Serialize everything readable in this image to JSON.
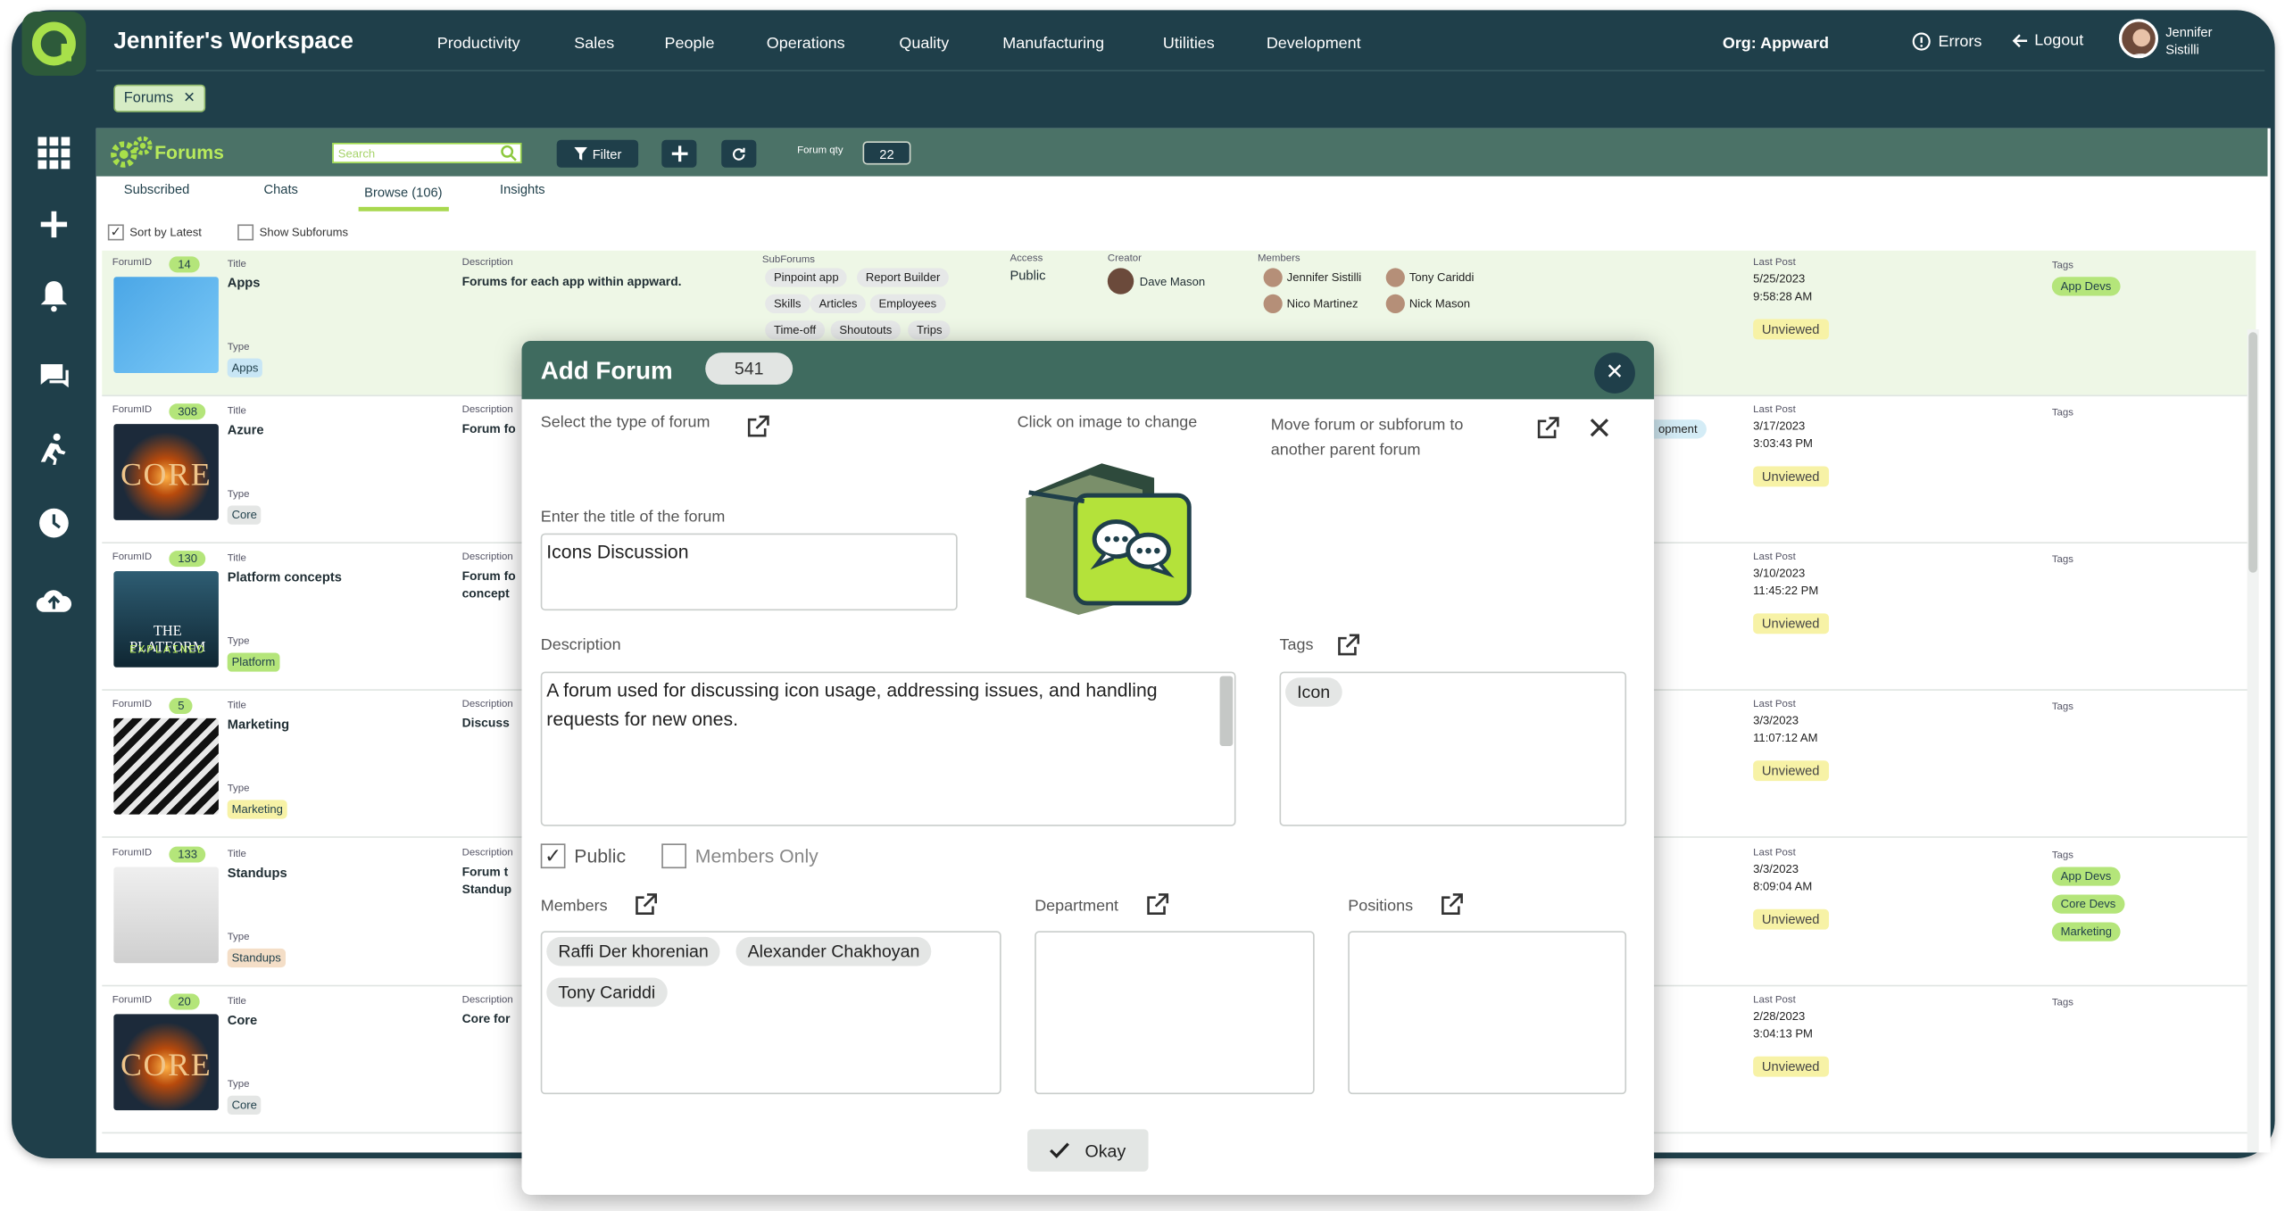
{
  "app": {
    "workspace_title": "Jennifer's Workspace",
    "menu": [
      "Productivity",
      "Sales",
      "People",
      "Operations",
      "Quality",
      "Manufacturing",
      "Utilities",
      "Development"
    ],
    "org_label": "Org:",
    "org_value": "Appward",
    "errors_label": "Errors",
    "logout_label": "Logout",
    "user_first": "Jennifer",
    "user_last": "Sistilli",
    "open_tab": "Forums",
    "colors": {
      "rail": "#1f3f4a",
      "accent": "#a8d84f",
      "toolbar": "#4b7267"
    }
  },
  "toolbar": {
    "title": "Forums",
    "search_placeholder": "Search",
    "filter_label": "Filter",
    "qty_label": "Forum qty",
    "qty_value": "22"
  },
  "subtabs": [
    "Subscribed",
    "Chats",
    "Browse (106)",
    "Insights"
  ],
  "options": {
    "sort_latest": "Sort by Latest",
    "show_subforums": "Show Subforums"
  },
  "labels": {
    "forum_id": "ForumID",
    "title": "Title",
    "type": "Type",
    "description": "Description",
    "subforums": "SubForums",
    "access": "Access",
    "creator": "Creator",
    "members": "Members",
    "last_post": "Last Post",
    "tags": "Tags",
    "unviewed": "Unviewed"
  },
  "rows": [
    {
      "id": "14",
      "title": "Apps",
      "type": "Apps",
      "description": "Forums for each app within appward.",
      "date": "5/25/2023",
      "time": "9:58:28 AM",
      "tags": [
        "App Devs"
      ]
    },
    {
      "id": "308",
      "title": "Azure",
      "type": "Core",
      "description": "Forum fo",
      "date": "3/17/2023",
      "time": "3:03:43 PM",
      "tags": []
    },
    {
      "id": "130",
      "title": "Platform concepts",
      "type": "Platform",
      "description": "Forum fo",
      "description2": "concept",
      "date": "3/10/2023",
      "time": "11:45:22 PM",
      "tags": []
    },
    {
      "id": "5",
      "title": "Marketing",
      "type": "Marketing",
      "description": "Discuss",
      "date": "3/3/2023",
      "time": "11:07:12 AM",
      "tags": []
    },
    {
      "id": "133",
      "title": "Standups",
      "type": "Standups",
      "description": "Forum t",
      "description2": "Standup",
      "date": "3/3/2023",
      "time": "8:09:04 AM",
      "tags": [
        "App Devs",
        "Core Devs",
        "Marketing"
      ]
    },
    {
      "id": "20",
      "title": "Core",
      "type": "Core",
      "description": "Core for",
      "date": "2/28/2023",
      "time": "3:04:13 PM",
      "tags": []
    }
  ],
  "apps_row": {
    "subforums": [
      "Pinpoint app",
      "Report Builder",
      "Skills",
      "Articles",
      "Employees",
      "Time-off",
      "Shoutouts",
      "Trips"
    ],
    "access": "Public",
    "creator": "Dave Mason",
    "members": [
      "Jennifer Sistilli",
      "Tony Cariddi",
      "Nico Martinez",
      "Nick Mason"
    ],
    "partial_pill": "opment"
  },
  "thumbs": {
    "core_text": "CORE",
    "platform_text1": "THE PLATFORM",
    "platform_text2": "EXPLAINED"
  },
  "modal": {
    "title": "Add Forum",
    "count": "541",
    "select_type": "Select the type of forum",
    "click_image": "Click on image to change",
    "move_forum": "Move forum or subforum to another parent forum",
    "title_label": "Enter the title of the forum",
    "title_value": "Icons Discussion",
    "description_label": "Description",
    "description_value": "A forum used for discussing icon usage, addressing issues, and handling requests for new ones.",
    "tags_label": "Tags",
    "tags": [
      "Icon"
    ],
    "public_label": "Public",
    "members_only_label": "Members Only",
    "members_label": "Members",
    "members": [
      "Raffi Der khorenian",
      "Alexander Chakhoyan",
      "Tony Cariddi"
    ],
    "department_label": "Department",
    "positions_label": "Positions",
    "okay_label": "Okay"
  }
}
